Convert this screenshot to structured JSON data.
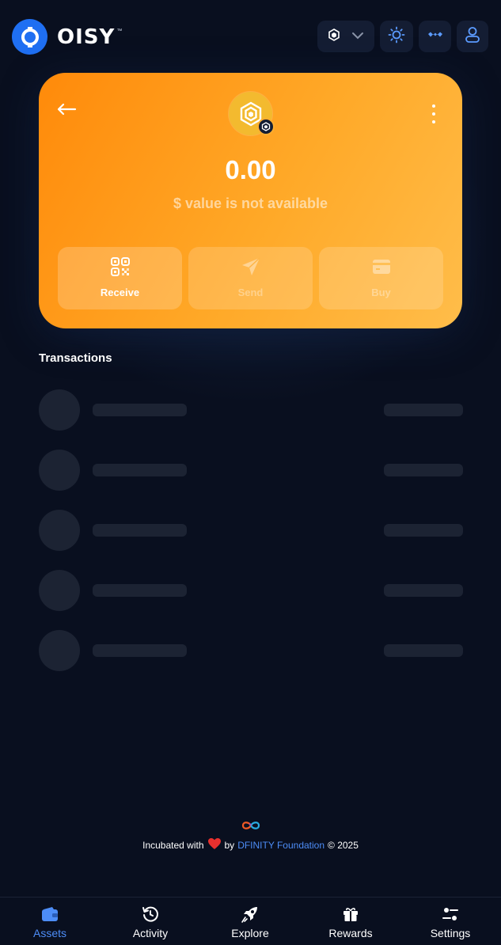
{
  "header": {
    "logo_text": "OISY",
    "logo_tm": "™",
    "network_icon": "bnb-icon",
    "theme_icon": "sun-icon",
    "walletconnect_icon": "walletconnect-icon",
    "user_icon": "user-icon"
  },
  "card": {
    "balance": "0.00",
    "usd_note": "$ value is not available",
    "token_icon": "bnb-token-icon",
    "actions": [
      {
        "label": "Receive",
        "enabled": true
      },
      {
        "label": "Send",
        "enabled": false
      },
      {
        "label": "Buy",
        "enabled": false
      }
    ]
  },
  "transactions": {
    "title": "Transactions",
    "loading_rows": 5
  },
  "footer": {
    "prefix": "Incubated with",
    "by": "by",
    "link": "DFINITY Foundation",
    "suffix": "© 2025"
  },
  "nav": {
    "items": [
      {
        "label": "Assets",
        "icon": "wallet-icon",
        "active": true
      },
      {
        "label": "Activity",
        "icon": "history-icon",
        "active": false
      },
      {
        "label": "Explore",
        "icon": "rocket-icon",
        "active": false
      },
      {
        "label": "Rewards",
        "icon": "gift-icon",
        "active": false
      },
      {
        "label": "Settings",
        "icon": "sliders-icon",
        "active": false
      }
    ]
  },
  "colors": {
    "background": "#090f1f",
    "accent": "#4d8df7",
    "card_gradient_start": "#ff8a0a",
    "card_gradient_end": "#ffbd4a",
    "skeleton": "#1c2333"
  }
}
